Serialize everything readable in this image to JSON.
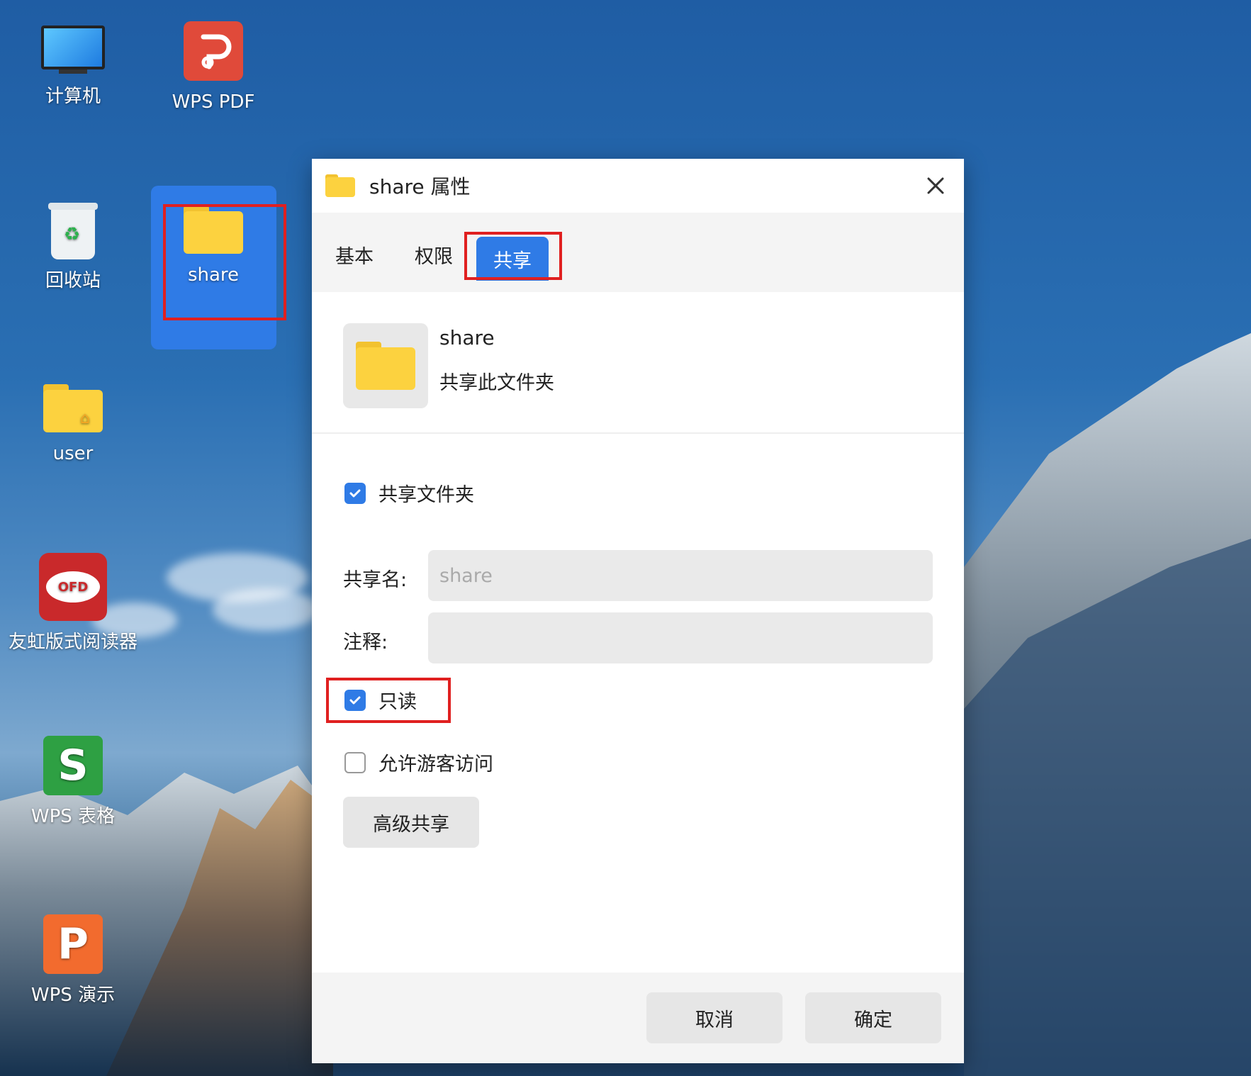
{
  "desktop": {
    "icons": [
      {
        "label": "计算机"
      },
      {
        "label": "WPS PDF"
      },
      {
        "label": "回收站"
      },
      {
        "label": "share"
      },
      {
        "label": "user"
      },
      {
        "label": "友虹版式阅读器"
      },
      {
        "label": "WPS 表格"
      },
      {
        "label": "WPS 演示"
      }
    ],
    "ofd_text": "OFD"
  },
  "dialog": {
    "title": "share 属性",
    "tabs": [
      "基本",
      "权限",
      "共享"
    ],
    "active_tab": "共享",
    "info": {
      "name": "share",
      "subtitle": "共享此文件夹"
    },
    "share_folder_label": "共享文件夹",
    "share_folder_checked": true,
    "share_name_label": "共享名:",
    "share_name_value": "share",
    "comment_label": "注释:",
    "comment_value": "",
    "readonly_label": "只读",
    "readonly_checked": true,
    "guest_label": "允许游客访问",
    "guest_checked": false,
    "advanced_button": "高级共享",
    "cancel_button": "取消",
    "ok_button": "确定"
  },
  "colors": {
    "accent": "#2f7be6",
    "highlight_box": "#e02020"
  }
}
